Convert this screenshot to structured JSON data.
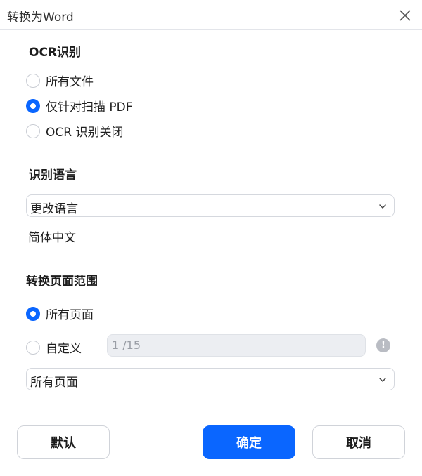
{
  "window": {
    "title": "转换为Word"
  },
  "ocr": {
    "section_title": "OCR识别",
    "options": [
      {
        "label": "所有文件",
        "selected": false
      },
      {
        "label": "仅针对扫描 PDF",
        "selected": true
      },
      {
        "label": "OCR 识别关闭",
        "selected": false
      }
    ]
  },
  "language": {
    "section_title": "识别语言",
    "dropdown_value": "更改语言",
    "current_language": "简体中文"
  },
  "page_range": {
    "section_title": "转换页面范围",
    "options": [
      {
        "label": "所有页面",
        "selected": true
      },
      {
        "label": "自定义",
        "selected": false
      }
    ],
    "custom_input_value": "1 /15",
    "info_icon_glyph": "!",
    "dropdown_value": "所有页面"
  },
  "footer": {
    "default_label": "默认",
    "confirm_label": "确定",
    "cancel_label": "取消"
  },
  "colors": {
    "accent": "#0a66ff"
  }
}
